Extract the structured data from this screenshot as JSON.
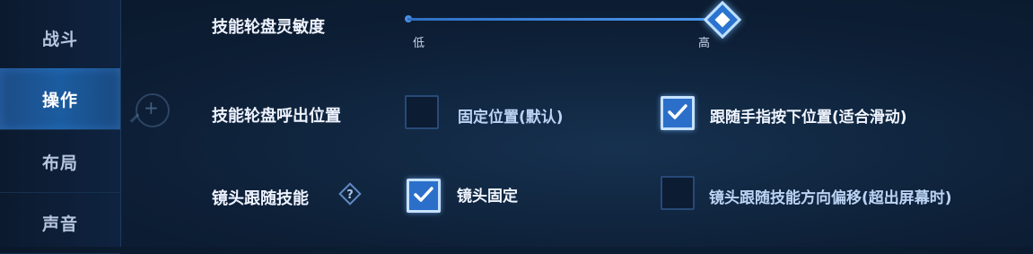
{
  "sidebar": {
    "items": [
      {
        "label": "战斗",
        "active": false
      },
      {
        "label": "操作",
        "active": true
      },
      {
        "label": "布局",
        "active": false
      },
      {
        "label": "声音",
        "active": false
      }
    ]
  },
  "sensitivity": {
    "label": "技能轮盘灵敏度",
    "min_label": "低",
    "max_label": "高",
    "value_fraction": 1.0
  },
  "wheel_position": {
    "label": "技能轮盘呼出位置",
    "option_fixed": {
      "label": "固定位置(默认)",
      "checked": false
    },
    "option_follow": {
      "label": "跟随手指按下位置(适合滑动)",
      "checked": true
    }
  },
  "camera_follow": {
    "label": "镜头跟随技能",
    "help_icon": "question-diamond-icon",
    "option_fixed": {
      "label": "镜头固定",
      "checked": true
    },
    "option_offset": {
      "label": "镜头跟随技能方向偏移(超出屏幕时)",
      "checked": false
    }
  },
  "colors": {
    "accent": "#2b6fca",
    "active_tab": "#1b5ca0",
    "checkmark": "#ffffff"
  }
}
